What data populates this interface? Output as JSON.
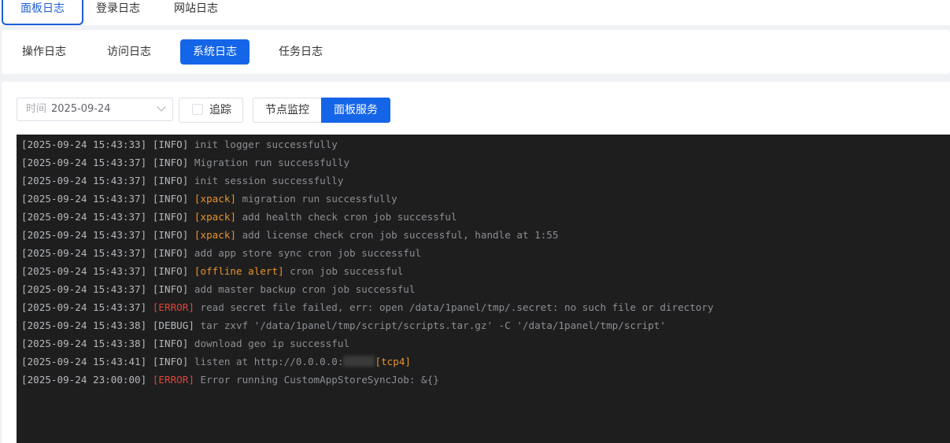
{
  "top_tabs": [
    {
      "label": "面板日志",
      "active": true
    },
    {
      "label": "登录日志",
      "active": false
    },
    {
      "label": "网站日志",
      "active": false
    }
  ],
  "sub_tabs": [
    {
      "label": "操作日志",
      "active": false
    },
    {
      "label": "访问日志",
      "active": false
    },
    {
      "label": "系统日志",
      "active": true
    },
    {
      "label": "任务日志",
      "active": false
    }
  ],
  "toolbar": {
    "date_label": "时间",
    "date_value": "2025-09-24",
    "tail_label": "追踪",
    "tail_checked": false,
    "group_buttons": [
      {
        "label": "节点监控",
        "active": false
      },
      {
        "label": "面板服务",
        "active": true
      }
    ]
  },
  "colors": {
    "accent": "#1565e8",
    "log_bg": "#1e1e1e",
    "tag": "#e7932f",
    "error": "#e0453a"
  },
  "logs": [
    {
      "ts": "[2025-09-24 15:43:33]",
      "level": "[INFO]",
      "tag": "",
      "msg": "init logger successfully"
    },
    {
      "ts": "[2025-09-24 15:43:37]",
      "level": "[INFO]",
      "tag": "",
      "msg": "Migration run successfully"
    },
    {
      "ts": "[2025-09-24 15:43:37]",
      "level": "[INFO]",
      "tag": "",
      "msg": "init session successfully"
    },
    {
      "ts": "[2025-09-24 15:43:37]",
      "level": "[INFO]",
      "tag": "[xpack]",
      "msg": "migration run successfully"
    },
    {
      "ts": "[2025-09-24 15:43:37]",
      "level": "[INFO]",
      "tag": "[xpack]",
      "msg": "add health check cron job successful"
    },
    {
      "ts": "[2025-09-24 15:43:37]",
      "level": "[INFO]",
      "tag": "[xpack]",
      "msg": "add license check cron job successful, handle at 1:55"
    },
    {
      "ts": "[2025-09-24 15:43:37]",
      "level": "[INFO]",
      "tag": "",
      "msg": "add app store sync cron job successful"
    },
    {
      "ts": "[2025-09-24 15:43:37]",
      "level": "[INFO]",
      "tag": "[offline alert]",
      "msg": "cron job successful"
    },
    {
      "ts": "[2025-09-24 15:43:37]",
      "level": "[INFO]",
      "tag": "",
      "msg": "add master backup cron job successful"
    },
    {
      "ts": "[2025-09-24 15:43:37]",
      "level": "[ERROR]",
      "tag": "",
      "msg": "read secret file failed, err: open /data/1panel/tmp/.secret: no such file or directory"
    },
    {
      "ts": "[2025-09-24 15:43:38]",
      "level": "[DEBUG]",
      "tag": "",
      "msg": "tar zxvf '/data/1panel/tmp/script/scripts.tar.gz' -C '/data/1panel/tmp/script'"
    },
    {
      "ts": "[2025-09-24 15:43:38]",
      "level": "[INFO]",
      "tag": "",
      "msg": "download geo ip successful"
    },
    {
      "ts": "[2025-09-24 15:43:41]",
      "level": "[INFO]",
      "tag": "",
      "msg": "listen at http://0.0.0.0:",
      "redacted": true,
      "tail": "[tcp4]"
    },
    {
      "ts": "[2025-09-24 23:00:00]",
      "level": "[ERROR]",
      "tag": "",
      "msg": "Error running CustomAppStoreSyncJob: &{}"
    }
  ]
}
